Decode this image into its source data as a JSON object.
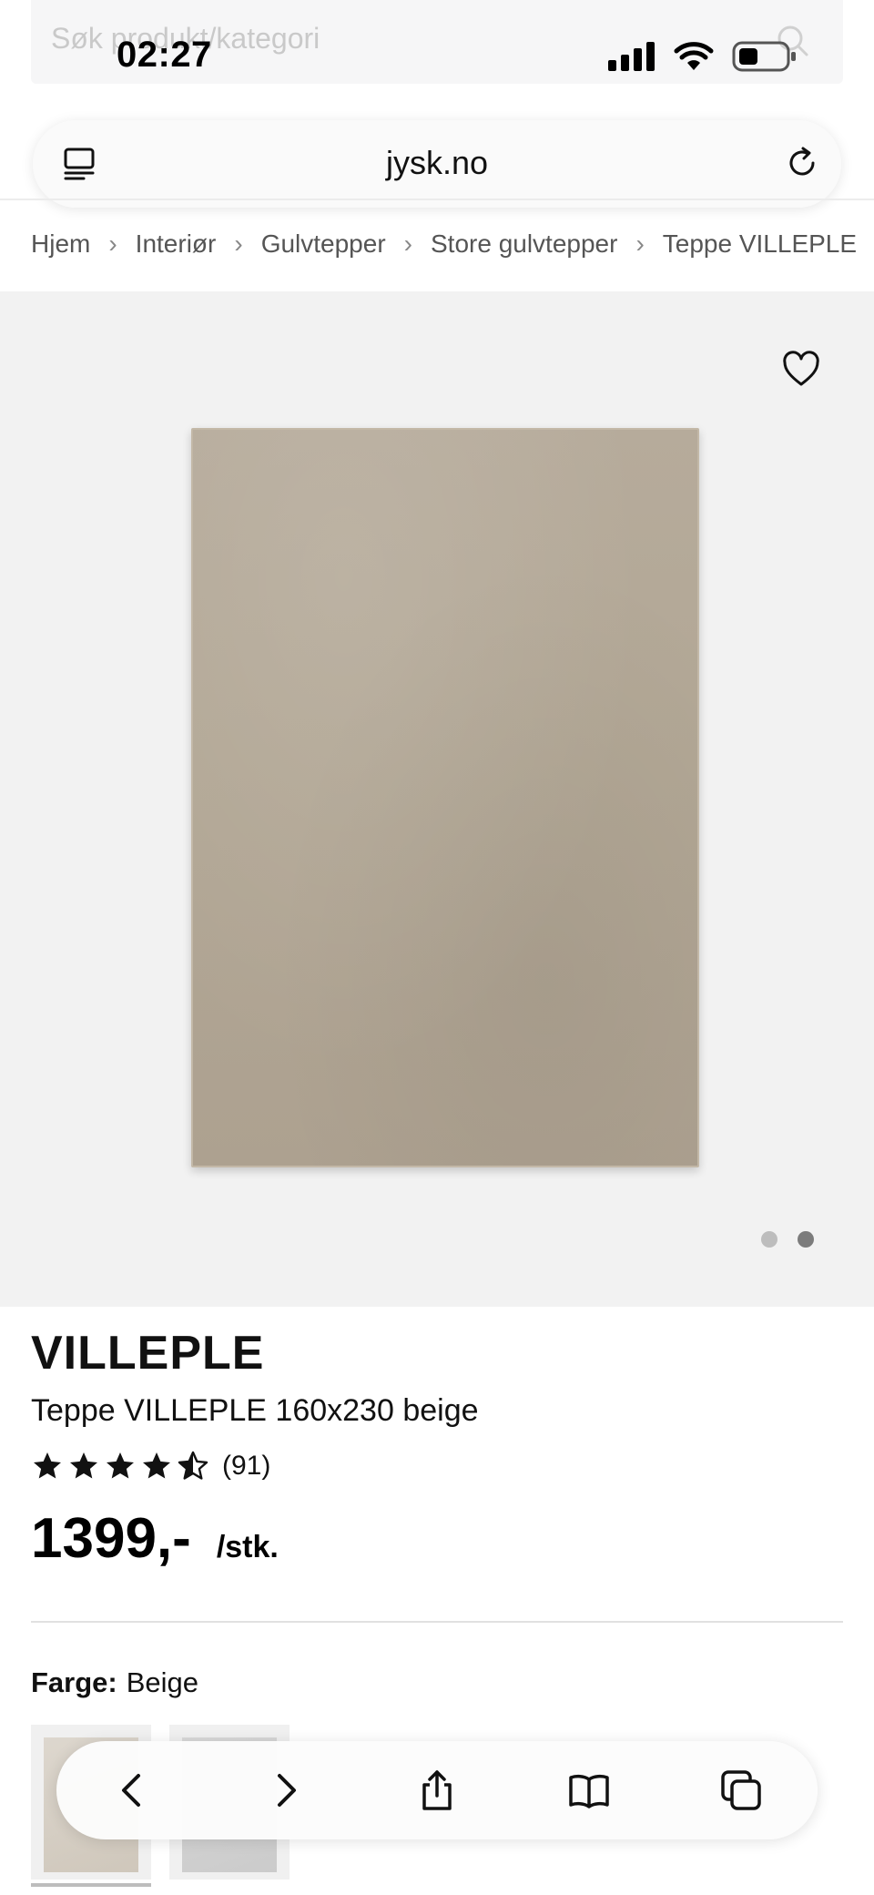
{
  "search": {
    "placeholder": "Søk produkt/kategori"
  },
  "status_bar": {
    "time": "02:27"
  },
  "browser": {
    "url": "jysk.no"
  },
  "breadcrumb": {
    "items": [
      "Hjem",
      "Interiør",
      "Gulvtepper",
      "Store gulvtepper",
      "Teppe VILLEPLE"
    ]
  },
  "gallery": {
    "image_count": 2,
    "active_index": 1
  },
  "product": {
    "brand": "VILLEPLE",
    "name": "Teppe VILLEPLE 160x230 beige",
    "rating": 4.5,
    "review_count": "(91)",
    "price": "1399,-",
    "unit": "/stk.",
    "color_label": "Farge:",
    "color_value": "Beige"
  },
  "colors": {
    "accent": "#111111",
    "gallery_bg": "#f2f2f2",
    "rug": "#b2a795"
  },
  "icons": {
    "toolbar": [
      "back-icon",
      "forward-icon",
      "share-icon",
      "bookmarks-icon",
      "tabs-icon"
    ]
  }
}
